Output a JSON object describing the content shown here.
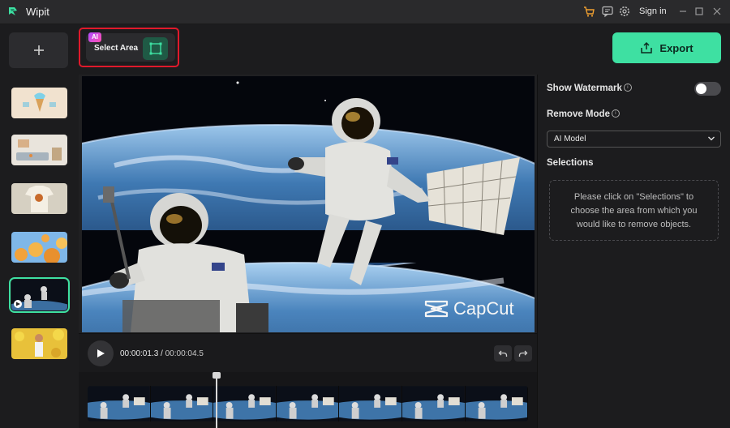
{
  "titlebar": {
    "app_name": "Wipit",
    "sign_in_label": "Sign in",
    "icons": [
      "cart-icon",
      "feedback-icon",
      "settings-icon",
      "minimize-icon",
      "maximize-icon",
      "close-icon"
    ]
  },
  "left_panel": {
    "add_icon": "plus-icon",
    "thumbnails": [
      {
        "name": "ice-cream",
        "active": false
      },
      {
        "name": "living-room",
        "active": false
      },
      {
        "name": "t-shirt",
        "active": false
      },
      {
        "name": "orange-flowers",
        "active": false
      },
      {
        "name": "astronauts",
        "active": true
      },
      {
        "name": "sunflower-girl",
        "active": false
      }
    ]
  },
  "toolbar": {
    "ai_badge": "AI",
    "select_area_label": "Select Area",
    "export_label": "Export"
  },
  "preview": {
    "watermark_text": "CapCut"
  },
  "playback": {
    "current_time": "00:00:01.3",
    "separator": "/",
    "total_time": "00:00:04.5"
  },
  "right_panel": {
    "show_watermark_label": "Show Watermark",
    "watermark_enabled": false,
    "remove_mode_label": "Remove Mode",
    "remove_mode_value": "AI Model",
    "selections_label": "Selections",
    "selections_hint": "Please click on \"Selections\" to choose the area from which you would like to remove objects."
  },
  "colors": {
    "accent": "#3ee0a2",
    "highlight_border": "#e0192b",
    "background": "#1c1c1e"
  }
}
